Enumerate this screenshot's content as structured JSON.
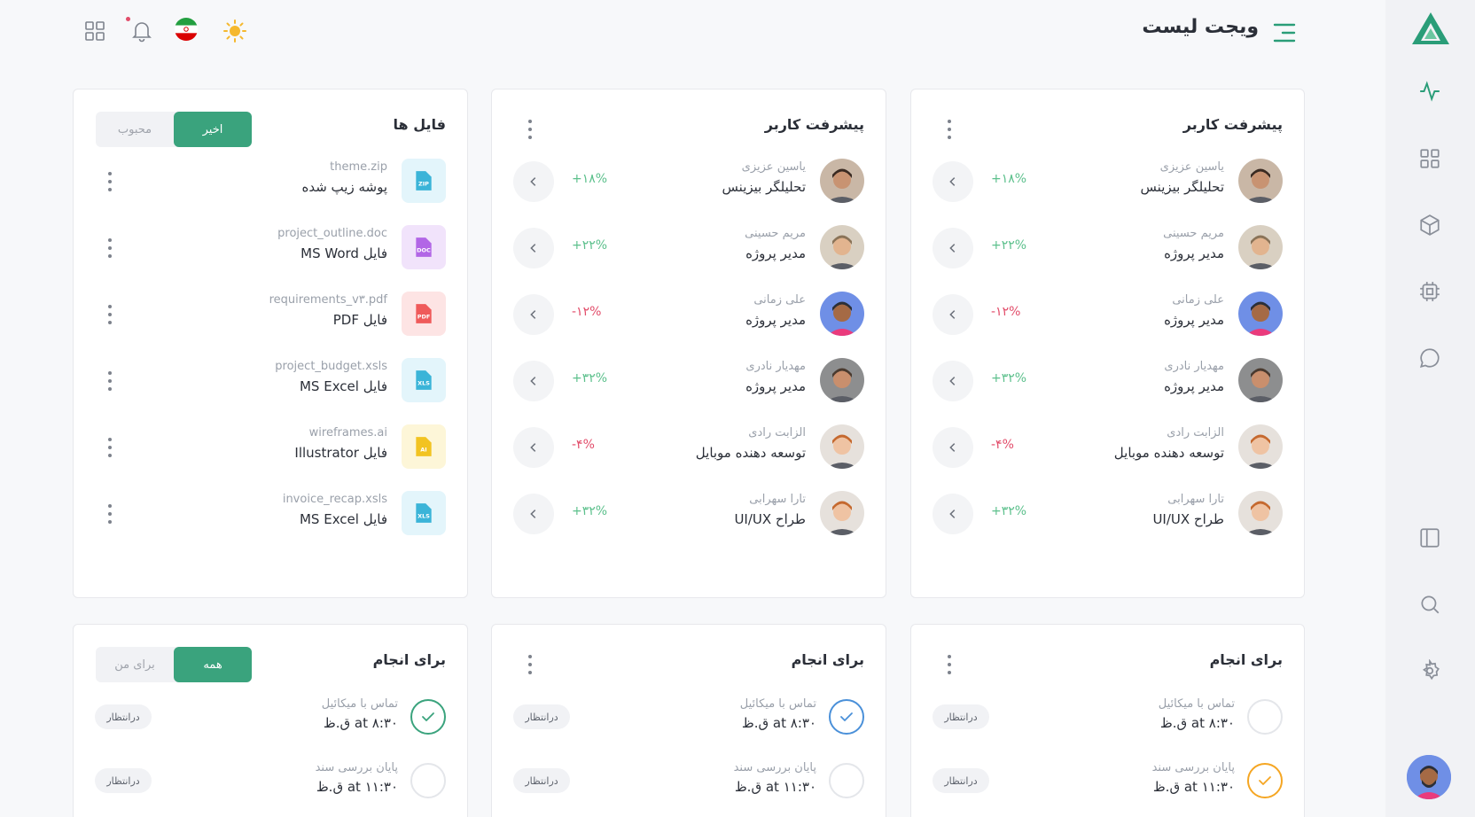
{
  "header": {
    "title": "ویجت لیست"
  },
  "colors": {
    "accent": "#3aa37d",
    "positive": "#5cc08c",
    "negative": "#e24d6a"
  },
  "sidebar": {
    "icons": [
      "activity-icon",
      "grid-icon",
      "box-icon",
      "cpu-icon",
      "chat-icon",
      "layout-icon",
      "search-icon",
      "settings-icon"
    ]
  },
  "progress_cards": [
    {
      "title": "پیشرفت کاربر",
      "users": [
        {
          "name": "یاسین عزیزی",
          "role": "تحلیلگر بیزینس",
          "change": "+۱۸%",
          "trend": "up"
        },
        {
          "name": "مریم حسینی",
          "role": "مدیر پروژه",
          "change": "+۲۲%",
          "trend": "up"
        },
        {
          "name": "علی زمانی",
          "role": "مدیر پروژه",
          "change": "-۱۲%",
          "trend": "down"
        },
        {
          "name": "مهدیار نادری",
          "role": "مدیر پروژه",
          "change": "+۳۲%",
          "trend": "up"
        },
        {
          "name": "الزابت رادی",
          "role": "توسعه دهنده موبایل",
          "change": "-۴%",
          "trend": "down"
        },
        {
          "name": "تارا سهرابی",
          "role": "طراح UI/UX",
          "change": "+۳۲%",
          "trend": "up"
        }
      ]
    },
    {
      "title": "پیشرفت کاربر",
      "users": [
        {
          "name": "یاسین عزیزی",
          "role": "تحلیلگر بیزینس",
          "change": "+۱۸%",
          "trend": "up"
        },
        {
          "name": "مریم حسینی",
          "role": "مدیر پروژه",
          "change": "+۲۲%",
          "trend": "up"
        },
        {
          "name": "علی زمانی",
          "role": "مدیر پروژه",
          "change": "-۱۲%",
          "trend": "down"
        },
        {
          "name": "مهدیار نادری",
          "role": "مدیر پروژه",
          "change": "+۳۲%",
          "trend": "up"
        },
        {
          "name": "الزابت رادی",
          "role": "توسعه دهنده موبایل",
          "change": "-۴%",
          "trend": "down"
        },
        {
          "name": "تارا سهرابی",
          "role": "طراح UI/UX",
          "change": "+۳۲%",
          "trend": "up"
        }
      ]
    }
  ],
  "files_card": {
    "title": "فایل ها",
    "tab_active": "اخیر",
    "tab_inactive": "محبوب",
    "files": [
      {
        "name": "theme.zip",
        "type": "پوشه زیپ شده",
        "icon": "zip-icon",
        "label": "ZIP",
        "bg": "#e3f5fb",
        "fg": "#3bb4d8"
      },
      {
        "name": "project_outline.doc",
        "type": "فایل MS Word",
        "icon": "doc-icon",
        "label": "DOC",
        "bg": "#f1e3fb",
        "fg": "#b266e6"
      },
      {
        "name": "requirements_v۳.pdf",
        "type": "فایل PDF",
        "icon": "pdf-icon",
        "label": "PDF",
        "bg": "#fde4e4",
        "fg": "#ef5a5a"
      },
      {
        "name": "project_budget.xsls",
        "type": "فایل MS Excel",
        "icon": "xls-icon",
        "label": "XLS",
        "bg": "#e3f5fb",
        "fg": "#3bb4d8"
      },
      {
        "name": "wireframes.ai",
        "type": "فایل Illustrator",
        "icon": "ai-icon",
        "label": "AI",
        "bg": "#fdf6d8",
        "fg": "#f2c321"
      },
      {
        "name": "invoice_recap.xsls",
        "type": "فایل MS Excel",
        "icon": "xls-icon",
        "label": "XLS",
        "bg": "#e3f5fb",
        "fg": "#3bb4d8"
      }
    ]
  },
  "todo_cards": [
    {
      "title": "برای انجام",
      "items": [
        {
          "name": "تماس با میکائیل",
          "time": "۸:۳۰ at ق.ظ",
          "status": "درانتظار",
          "check": "empty"
        },
        {
          "name": "پایان بررسی سند",
          "time": "۱۱:۳۰ at ق.ظ",
          "status": "درانتظار",
          "check": "orange"
        }
      ]
    },
    {
      "title": "برای انجام",
      "items": [
        {
          "name": "تماس با میکائیل",
          "time": "۸:۳۰ at ق.ظ",
          "status": "درانتظار",
          "check": "blue"
        },
        {
          "name": "پایان بررسی سند",
          "time": "۱۱:۳۰ at ق.ظ",
          "status": "درانتظار",
          "check": "empty"
        }
      ]
    },
    {
      "title": "برای انجام",
      "tab_active": "همه",
      "tab_inactive": "برای من",
      "items": [
        {
          "name": "تماس با میکائیل",
          "time": "۸:۳۰ at ق.ظ",
          "status": "درانتظار",
          "check": "green"
        },
        {
          "name": "پایان بررسی سند",
          "time": "۱۱:۳۰ at ق.ظ",
          "status": "درانتظار",
          "check": "empty"
        }
      ]
    }
  ]
}
